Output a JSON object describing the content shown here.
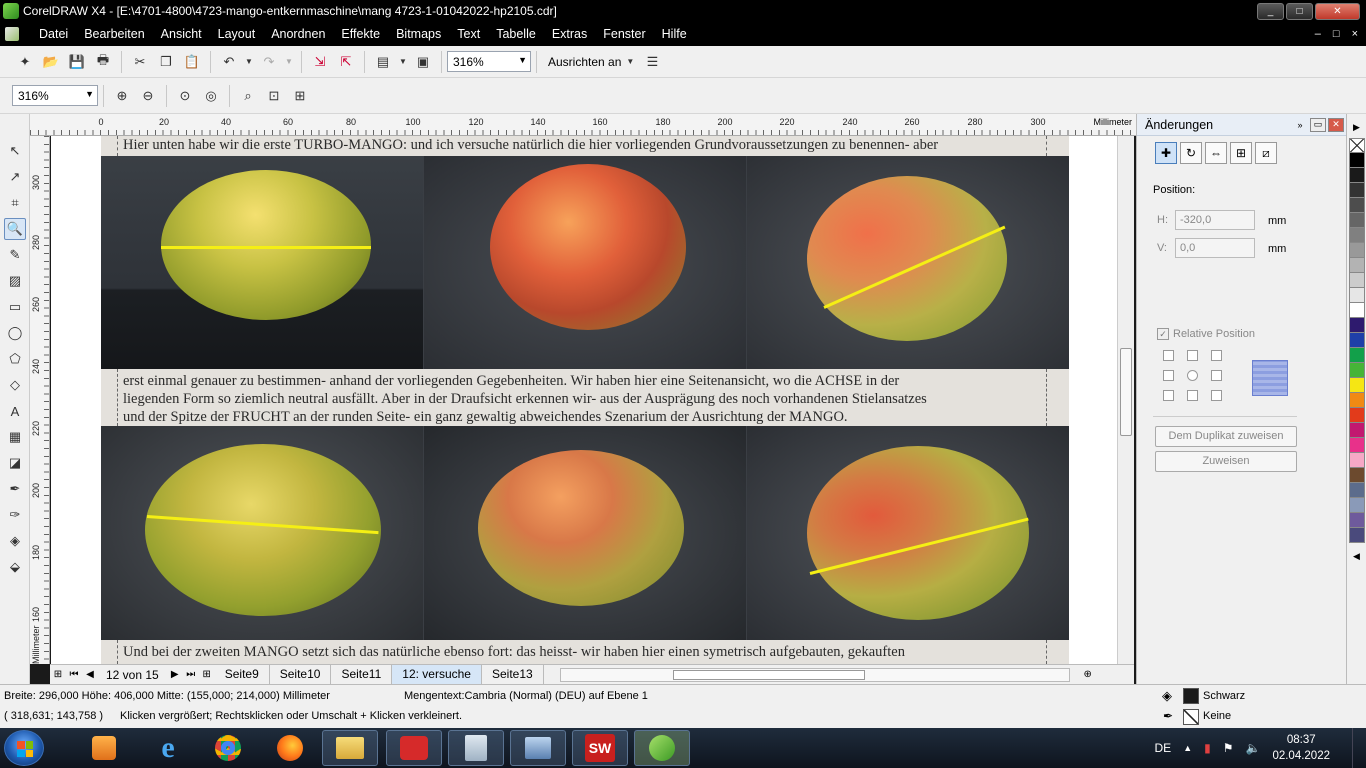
{
  "window": {
    "title": "CorelDRAW X4 - [E:\\4701-4800\\4723-mango-entkernmaschine\\mang 4723-1-01042022-hp2105.cdr]",
    "controls": [
      "_",
      "□",
      "✕"
    ]
  },
  "menu": {
    "items": [
      "Datei",
      "Bearbeiten",
      "Ansicht",
      "Layout",
      "Anordnen",
      "Effekte",
      "Bitmaps",
      "Text",
      "Tabelle",
      "Extras",
      "Fenster",
      "Hilfe"
    ],
    "doc_controls": [
      "–",
      "□",
      "×"
    ]
  },
  "toolbar": {
    "zoom_value": "316%",
    "align_label": "Ausrichten an"
  },
  "zoombar": {
    "zoom_value": "316%"
  },
  "ruler": {
    "top_ticks": [
      "0",
      "20",
      "40",
      "60",
      "80",
      "100",
      "120",
      "140",
      "160",
      "180",
      "200",
      "220",
      "240",
      "260",
      "280",
      "300"
    ],
    "unit": "Millimeter",
    "left_ticks": [
      "300",
      "280",
      "260",
      "240",
      "220",
      "200",
      "180",
      "160"
    ],
    "left_unit": "Millimeter"
  },
  "document": {
    "text1": "Hier unten habe wir die erste TURBO-MANGO: und ich versuche natürlich die hier vorliegenden Grundvoraussetzungen zu benennen- aber",
    "text2_lines": [
      "erst einmal genauer zu bestimmen- anhand der vorliegenden Gegebenheiten. Wir haben hier eine Seitenansicht, wo die ACHSE in der",
      "liegenden Form so ziemlich neutral ausfällt. Aber in der Draufsicht erkennen wir- aus der Ausprägung des noch vorhandenen Stielansatzes",
      "und der Spitze der FRUCHT an der runden Seite- ein ganz gewaltig abweichendes Szenarium der Ausrichtung der MANGO."
    ],
    "text3": "Und bei der zweiten MANGO setzt sich das natürliche ebenso fort: das heisst- wir haben hier einen symetrisch aufgebauten, gekauften"
  },
  "pagebar": {
    "page_count": "12 von 15",
    "tabs": [
      "Seite9",
      "Seite10",
      "Seite11",
      "12: versuche",
      "Seite13"
    ],
    "active_tab": "12: versuche"
  },
  "docker": {
    "title": "Änderungen",
    "position_label": "Position:",
    "h_label": "H:",
    "h_value": "-320,0",
    "v_label": "V:",
    "v_value": "0,0",
    "unit": "mm",
    "relative_position_label": "Relative Position",
    "duplicate_button": "Dem Duplikat zuweisen",
    "apply_button": "Zuweisen"
  },
  "palette": {
    "colors": [
      "#000000",
      "#1a1a1a",
      "#333333",
      "#4d4d4d",
      "#666666",
      "#808080",
      "#999999",
      "#b3b3b3",
      "#cccccc",
      "#e6e6e6",
      "#ffffff",
      "#2e1a6e",
      "#1f3fa8",
      "#12a04a",
      "#46b437",
      "#f5e614",
      "#f08a14",
      "#e23b1b",
      "#c21870",
      "#e8318a",
      "#f6a8c6",
      "#6c4a2e",
      "#5c6c8c",
      "#8a9ab8",
      "#6e5a9c",
      "#4a4a7c"
    ]
  },
  "status": {
    "dimensions": "Breite: 296,000 Höhe: 406,000 Mitte: (155,000; 214,000) Millimeter",
    "object_info": "Mengentext:Cambria (Normal) (DEU) auf Ebene 1",
    "cursor": "( 318,631; 143,758 )",
    "hint": "Klicken vergrößert; Rechtsklicken oder Umschalt + Klicken verkleinert.",
    "fill_label": "Schwarz",
    "outline_label": "Keine",
    "fill_color": "#1a1a1a"
  },
  "taskbar": {
    "language": "DE",
    "time": "08:37",
    "date": "02.04.2022"
  }
}
